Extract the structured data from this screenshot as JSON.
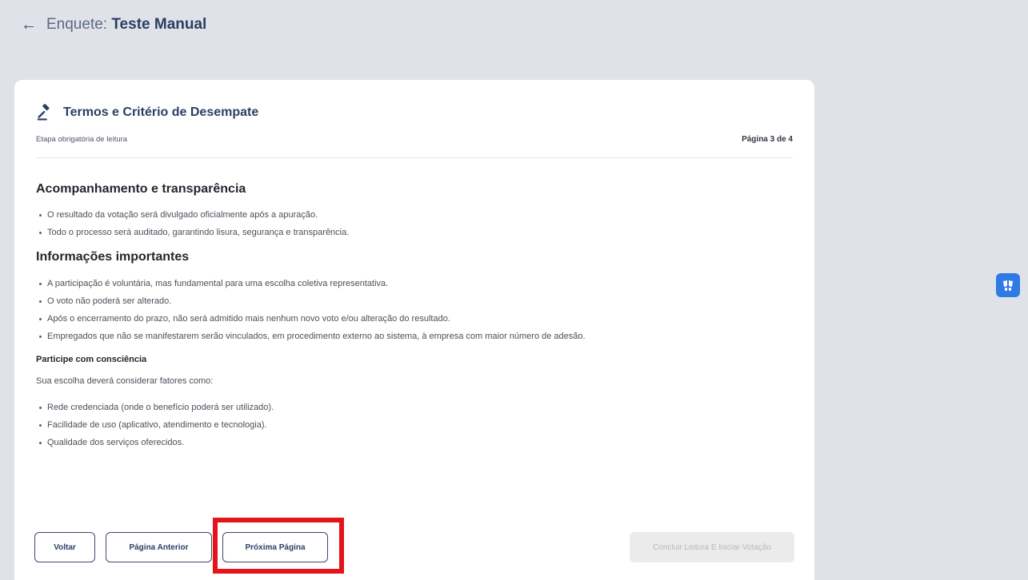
{
  "header": {
    "prefix": "Enquete:",
    "title": "Teste Manual"
  },
  "card": {
    "title": "Termos e Critério de Desempate",
    "subtitle": "Etapa obrigatória de leitura",
    "page_indicator": "Página 3 de 4"
  },
  "sections": {
    "transparency": {
      "heading": "Acompanhamento e transparência",
      "items": [
        "O resultado da votação será divulgado oficialmente após a apuração.",
        "Todo o processo será auditado, garantindo lisura, segurança e transparência."
      ]
    },
    "important": {
      "heading": "Informações importantes",
      "items": [
        "A participação é voluntária, mas fundamental para uma escolha coletiva representativa.",
        "O voto não poderá ser alterado.",
        "Após o encerramento do prazo, não será admitido mais nenhum novo voto e/ou alteração do resultado.",
        "Empregados que não se manifestarem serão vinculados, em procedimento externo ao sistema, à empresa com maior número de adesão."
      ]
    },
    "awareness": {
      "heading": "Participe com consciência",
      "intro": "Sua escolha deverá considerar fatores como:",
      "items": [
        "Rede credenciada (onde o benefício poderá ser utilizado).",
        "Facilidade de uso (aplicativo, atendimento e tecnologia).",
        "Qualidade dos serviços oferecidos."
      ]
    }
  },
  "buttons": {
    "back": "Voltar",
    "previous": "Página Anterior",
    "next": "Próxima Página",
    "finish": "Concluir Leitura E Iniciar Votação"
  },
  "icons": {
    "back": "arrow-left-icon",
    "title": "gavel-icon",
    "widget": "accessibility-icon"
  },
  "colors": {
    "highlight": "#e3141b",
    "widget": "#2f7ae5",
    "primary": "#2c3e63"
  }
}
